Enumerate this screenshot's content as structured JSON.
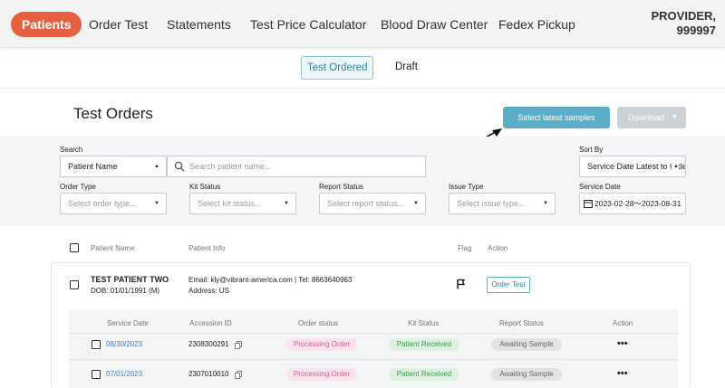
{
  "nav": {
    "items": [
      {
        "label": "Patients",
        "active": true
      },
      {
        "label": "Order Test"
      },
      {
        "label": "Statements"
      },
      {
        "label": "Test Price Calculator"
      },
      {
        "label": "Blood Draw Center"
      },
      {
        "label": "Fedex Pickup"
      }
    ],
    "provider_line1": "PROVIDER,",
    "provider_line2": "999997"
  },
  "subtabs": [
    {
      "label": "Test Ordered",
      "active": true
    },
    {
      "label": "Draft"
    }
  ],
  "header": {
    "title": "Test Orders",
    "latest_button": "Select latest samples",
    "download_button": "Download"
  },
  "filters": {
    "search_label": "Search",
    "search_type": "Patient Name",
    "search_placeholder": "Search patient name...",
    "sort_label": "Sort By",
    "sort_value": "Service Date Latest to Oldest",
    "order_type_label": "Order Type",
    "order_type_placeholder": "Select order type...",
    "kit_status_label": "Kit Status",
    "kit_status_placeholder": "Select kit status...",
    "report_status_label": "Report Status",
    "report_status_placeholder": "Select report status...",
    "issue_type_label": "Issue Type",
    "issue_type_placeholder": "Select issue type...",
    "service_date_label": "Service Date",
    "service_date_value": "2023-02-28～2023-08-31"
  },
  "table": {
    "headers": {
      "name": "Patient Name",
      "info": "Patient Info",
      "flag": "Flag",
      "action": "Action"
    }
  },
  "patient": {
    "name": "TEST PATIENT TWO",
    "dob": "DOB: 01/01/1991  (M)",
    "contact": "Email: kly@vibrant-america.com  |  Tel: 8663640963",
    "address": "Address: US",
    "order_button": "Order Test"
  },
  "orders": {
    "headers": {
      "service_date": "Service Date",
      "accession": "Accession ID",
      "order_status": "Order status",
      "kit_status": "Kit Status",
      "report_status": "Report Status",
      "action": "Action"
    },
    "rows": [
      {
        "date": "08/30/2023",
        "accession": "2308300291",
        "order_status": "Processing Order",
        "kit_status": "Patient Received",
        "report_status": "Awaiting Sample",
        "action": "•••"
      },
      {
        "date": "07/01/2023",
        "accession": "2307010010",
        "order_status": "Processing Order",
        "kit_status": "Patient Received",
        "report_status": "Awaiting Sample",
        "action": "•••"
      }
    ]
  }
}
